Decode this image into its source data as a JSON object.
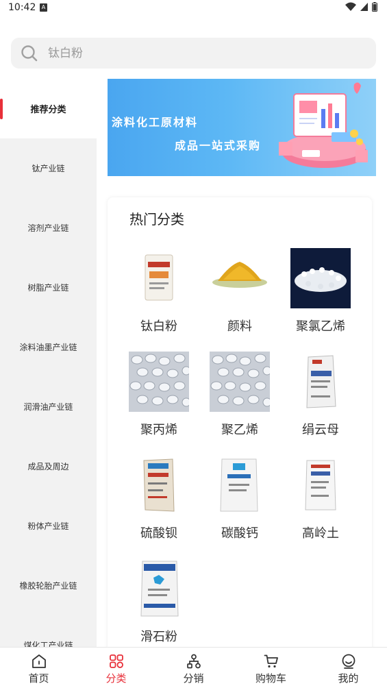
{
  "status_bar": {
    "time": "10:42",
    "app_indicator": "A"
  },
  "search": {
    "placeholder": "钛白粉"
  },
  "sidebar": {
    "items": [
      {
        "label": "推荐分类",
        "active": true
      },
      {
        "label": "钛产业链"
      },
      {
        "label": "溶剂产业链"
      },
      {
        "label": "树脂产业链"
      },
      {
        "label": "涂料油墨产业链"
      },
      {
        "label": "润滑油产业链"
      },
      {
        "label": "成品及周边"
      },
      {
        "label": "粉体产业链"
      },
      {
        "label": "橡胶轮胎产业链"
      },
      {
        "label": "煤化工产业链"
      }
    ]
  },
  "banner": {
    "line1": "涂料化工原材料",
    "line2": "成品一站式采购"
  },
  "hot": {
    "title": "热门分类",
    "items": [
      {
        "label": "钛白粉",
        "icon": "titanium-dioxide-bag-image"
      },
      {
        "label": "颜料",
        "icon": "pigment-powder-image"
      },
      {
        "label": "聚氯乙烯",
        "icon": "pvc-granules-image"
      },
      {
        "label": "聚丙烯",
        "icon": "polypropylene-pellets-image"
      },
      {
        "label": "聚乙烯",
        "icon": "polyethylene-pellets-image"
      },
      {
        "label": "绢云母",
        "icon": "sericite-bag-image"
      },
      {
        "label": "硫酸钡",
        "icon": "barium-sulfate-bag-image"
      },
      {
        "label": "碳酸钙",
        "icon": "calcium-carbonate-bag-image"
      },
      {
        "label": "高岭土",
        "icon": "kaolin-bag-image"
      },
      {
        "label": "滑石粉",
        "icon": "talc-powder-bag-image"
      }
    ]
  },
  "tabbar": {
    "items": [
      {
        "label": "首页",
        "icon": "home-icon"
      },
      {
        "label": "分类",
        "icon": "category-icon",
        "active": true
      },
      {
        "label": "分销",
        "icon": "distribution-icon"
      },
      {
        "label": "购物车",
        "icon": "cart-icon"
      },
      {
        "label": "我的",
        "icon": "profile-icon"
      }
    ]
  },
  "colors": {
    "accent": "#e8303a",
    "sidebar_bg": "#f2f2f2",
    "banner_blue": "#4aa6f0"
  }
}
